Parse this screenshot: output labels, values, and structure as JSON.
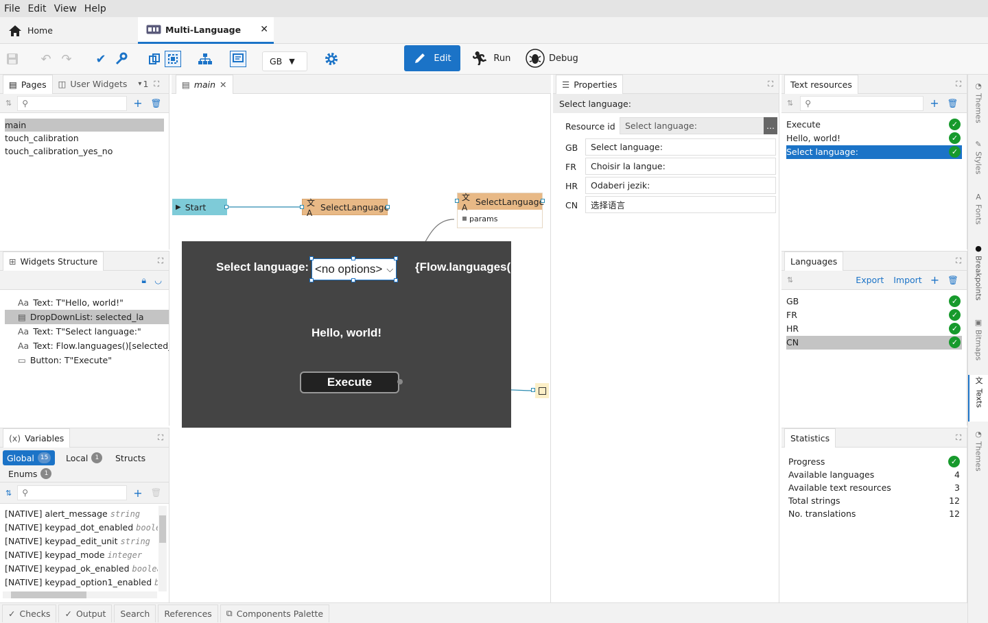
{
  "menu": [
    "File",
    "Edit",
    "View",
    "Help"
  ],
  "tabs": {
    "home": "Home",
    "project": "Multi-Language"
  },
  "toolbar": {
    "lang_select": "GB",
    "edit": "Edit",
    "run": "Run",
    "debug": "Debug"
  },
  "pages_panel": {
    "tab_pages": "Pages",
    "tab_widgets": "User Widgets",
    "count": "1",
    "items": [
      "main",
      "touch_calibration",
      "touch_calibration_yes_no"
    ]
  },
  "editor": {
    "tab": "main"
  },
  "widgets_structure": {
    "title": "Widgets Structure",
    "items": [
      "Text: T\"Hello, world!\"",
      "DropDownList: selected_la",
      "Text: T\"Select language:\"",
      "Text: Flow.languages()[selected_",
      "Button: T\"Execute\""
    ]
  },
  "variables": {
    "title": "Variables",
    "tabs": {
      "global": "Global",
      "global_count": "15",
      "local": "Local",
      "local_count": "1",
      "structs": "Structs",
      "enums": "Enums",
      "enums_count": "1"
    },
    "items": [
      {
        "name": "[NATIVE] alert_message",
        "type": "string"
      },
      {
        "name": "[NATIVE] keypad_dot_enabled",
        "type": "boolean"
      },
      {
        "name": "[NATIVE] keypad_edit_unit",
        "type": "string"
      },
      {
        "name": "[NATIVE] keypad_mode",
        "type": "integer"
      },
      {
        "name": "[NATIVE] keypad_ok_enabled",
        "type": "boolean"
      },
      {
        "name": "[NATIVE] keypad_option1_enabled",
        "type": "boolean"
      }
    ]
  },
  "flow": {
    "start": "Start",
    "select_language_1": "SelectLanguage",
    "select_language_2": "SelectLanguage",
    "params": "params",
    "widget_label": "Select language:",
    "dropdown": "<no options>",
    "expr": "{Flow.languages(",
    "hello": "Hello, world!",
    "execute": "Execute"
  },
  "properties": {
    "title": "Properties",
    "object": "Select language:",
    "resource_id_label": "Resource id",
    "resource_id_value": "Select language:",
    "translations": [
      {
        "lang": "GB",
        "text": "Select language:"
      },
      {
        "lang": "FR",
        "text": "Choisir la langue:"
      },
      {
        "lang": "HR",
        "text": "Odaberi jezik:"
      },
      {
        "lang": "CN",
        "text": "选择语言"
      }
    ]
  },
  "text_resources": {
    "title": "Text resources",
    "items": [
      "Execute",
      "Hello, world!",
      "Select language:"
    ]
  },
  "languages": {
    "title": "Languages",
    "export": "Export",
    "import": "Import",
    "items": [
      "GB",
      "FR",
      "HR",
      "CN"
    ]
  },
  "statistics": {
    "title": "Statistics",
    "rows": [
      {
        "label": "Progress",
        "value": ""
      },
      {
        "label": "Available languages",
        "value": "4"
      },
      {
        "label": "Available text resources",
        "value": "3"
      },
      {
        "label": "Total strings",
        "value": "12"
      },
      {
        "label": "No. translations",
        "value": "12"
      }
    ]
  },
  "right_tabs": [
    "Themes",
    "Styles",
    "Fonts",
    "Breakpoints",
    "Bitmaps",
    "Texts",
    "Themes"
  ],
  "bottom_tabs": [
    "Checks",
    "Output",
    "Search",
    "References",
    "Components Palette"
  ],
  "colors": {
    "accent": "#1b73c7",
    "ok": "#179a2c",
    "node": "#e8b986",
    "start": "#7ecbd8",
    "canvas": "#444444"
  }
}
